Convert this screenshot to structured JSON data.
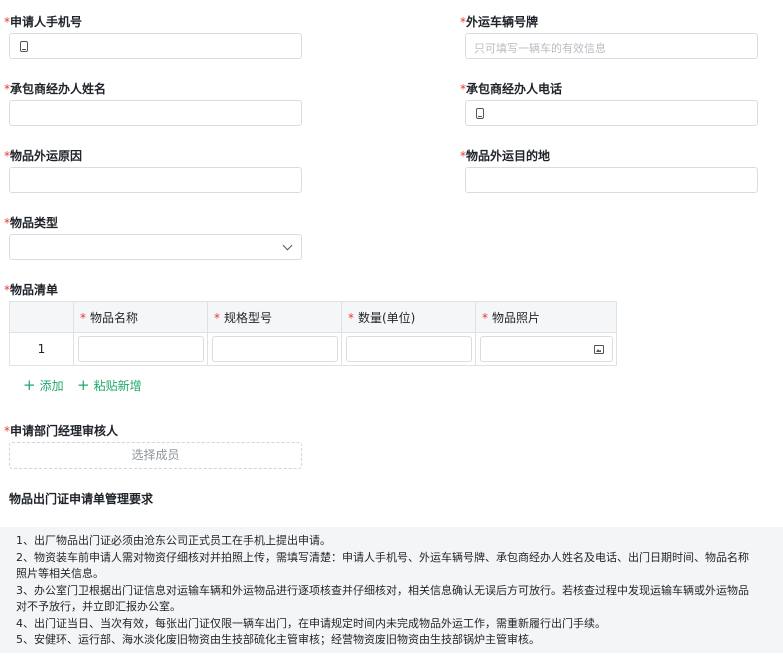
{
  "fields": {
    "applicant_phone": {
      "label": "申请人手机号",
      "value": ""
    },
    "vehicle_plate": {
      "label": "外运车辆号牌",
      "placeholder": "只可填写一辆车的有效信息"
    },
    "contractor_name": {
      "label": "承包商经办人姓名",
      "value": ""
    },
    "contractor_phone": {
      "label": "承包商经办人电话",
      "value": ""
    },
    "reason": {
      "label": "物品外运原因",
      "value": ""
    },
    "destination": {
      "label": "物品外运目的地",
      "value": ""
    },
    "item_type": {
      "label": "物品类型",
      "value": ""
    }
  },
  "required_mark": "*",
  "item_list": {
    "label": "物品清单",
    "columns": [
      "物品名称",
      "规格型号",
      "数量(单位)",
      "物品照片"
    ],
    "rows": [
      {
        "index": "1"
      }
    ],
    "add_label": "添加",
    "paste_label": "粘贴新增"
  },
  "approver": {
    "label": "申请部门经理审核人",
    "button": "选择成员"
  },
  "requirements": {
    "title": "物品出门证申请单管理要求",
    "lines": [
      "1、出厂物品出门证必须由沧东公司正式员工在手机上提出申请。",
      "2、物资装车前申请人需对物资仔细核对并拍照上传，需填写清楚：申请人手机号、外运车辆号牌、承包商经办人姓名及电话、出门日期时间、物品名称",
      "照片等相关信息。",
      "3、办公室门卫根据出门证信息对运输车辆和外运物品进行逐项核查并仔细核对，相关信息确认无误后方可放行。若核查过程中发现运输车辆或外运物品",
      "对不予放行，并立即汇报办公室。",
      "4、出门证当日、当次有效，每张出门证仅限一辆车出门，在申请规定时间内未完成物品外运工作，需重新履行出门手续。",
      "5、安健环、运行部、海水淡化废旧物资由生技部硫化主管审核；经营物资废旧物资由生技部锅炉主管审核。"
    ]
  },
  "colors": {
    "required": "#e53935",
    "accent": "#20a86b"
  },
  "icons": {
    "phone": "mobile-phone-icon",
    "chevron": "chevron-down-icon",
    "image": "image-icon",
    "plus": "plus-icon"
  }
}
